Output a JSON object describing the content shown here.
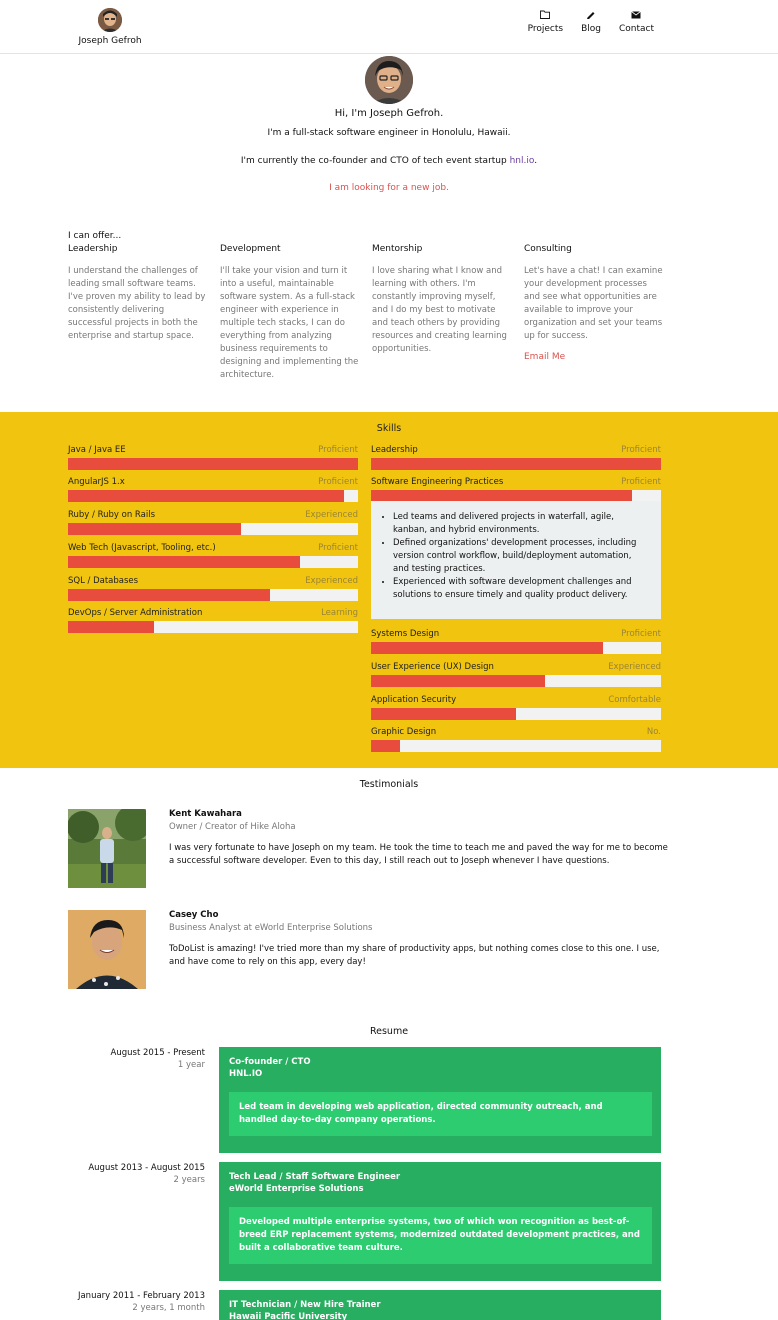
{
  "nav": {
    "brand_name": "Joseph Gefroh",
    "links": [
      {
        "label": "Projects",
        "icon": "folder-icon"
      },
      {
        "label": "Blog",
        "icon": "pencil-icon"
      },
      {
        "label": "Contact",
        "icon": "envelope-icon"
      }
    ]
  },
  "hero": {
    "greeting": "Hi, I'm Joseph Gefroh.",
    "line1": "I'm a full-stack software engineer in Honolulu, Hawaii.",
    "line2_prefix": "I'm currently the co-founder and CTO of tech event startup ",
    "line2_link": "hnl.io",
    "line2_suffix": ".",
    "job_notice": "I am looking for a new job."
  },
  "offers": {
    "title": "I can offer...",
    "items": [
      {
        "title": "Leadership",
        "text": "I understand the challenges of leading small software teams. I've proven my ability to lead by consistently delivering successful projects in both the enterprise and startup space."
      },
      {
        "title": "Development",
        "text": "I'll take your vision and turn it into a useful, maintainable software system. As a full-stack engineer with experience in multiple tech stacks, I can do everything from analyzing business requirements to designing and implementing the architecture."
      },
      {
        "title": "Mentorship",
        "text": "I love sharing what I know and learning with others. I'm constantly improving myself, and I do my best to motivate and teach others by providing resources and creating learning opportunities."
      },
      {
        "title": "Consulting",
        "text": "Let's have a chat! I can examine your development processes and see what opportunities are available to improve your organization and set your teams up for success.",
        "link": "Email Me"
      }
    ]
  },
  "skills": {
    "title": "Skills",
    "left": [
      {
        "name": "Java / Java EE",
        "level": "Proficient",
        "fill": 1.0
      },
      {
        "name": "AngularJS 1.x",
        "level": "Proficient",
        "fill": 0.95
      },
      {
        "name": "Ruby / Ruby on Rails",
        "level": "Experienced",
        "fill": 0.595
      },
      {
        "name": "Web Tech (Javascript, Tooling, etc.)",
        "level": "Proficient",
        "fill": 0.8
      },
      {
        "name": "SQL / Databases",
        "level": "Experienced",
        "fill": 0.695
      },
      {
        "name": "DevOps / Server Administration",
        "level": "Learning",
        "fill": 0.295
      }
    ],
    "right": [
      {
        "name": "Leadership",
        "level": "Proficient",
        "fill": 1.0
      },
      {
        "name": "Software Engineering Practices",
        "level": "Proficient",
        "fill": 0.9
      },
      {
        "name": "Systems Design",
        "level": "Proficient",
        "fill": 0.8
      },
      {
        "name": "User Experience (UX) Design",
        "level": "Experienced",
        "fill": 0.6
      },
      {
        "name": "Application Security",
        "level": "Comfortable",
        "fill": 0.5
      },
      {
        "name": "Graphic Design",
        "level": "No.",
        "fill": 0.1
      }
    ],
    "detail": [
      "Led teams and delivered projects in waterfall, agile, kanban, and hybrid environments.",
      "Defined organizations' development processes, including version control workflow, build/deployment automation, and testing practices.",
      "Experienced with software development challenges and solutions to ensure timely and quality product delivery."
    ]
  },
  "testimonials": {
    "title": "Testimonials",
    "items": [
      {
        "name": "Kent Kawahara",
        "role": "Owner / Creator of Hike Aloha",
        "quote": "I was very fortunate to have Joseph on my team. He took the time to teach me and paved the way for me to become a successful software developer. Even to this day, I still reach out to Joseph whenever I have questions."
      },
      {
        "name": "Casey Cho",
        "role": "Business Analyst at eWorld Enterprise Solutions",
        "quote": "ToDoList is amazing! I've tried more than my share of productivity apps, but nothing comes close to this one. I use, and have come to rely on this app, every day!"
      }
    ]
  },
  "resume": {
    "title": "Resume",
    "jobs": [
      {
        "dates": "August 2015 - Present",
        "duration": "1 year",
        "title": "Co-founder / CTO",
        "company": "HNL.IO",
        "desc": "Led team in developing web application, directed community outreach, and handled day-to-day company operations."
      },
      {
        "dates": "August 2013 - August 2015",
        "duration": "2 years",
        "title": "Tech Lead / Staff Software Engineer",
        "company": "eWorld Enterprise Solutions",
        "desc": "Developed multiple enterprise systems, two of which won recognition as best-of-breed ERP replacement systems, modernized outdated development practices, and built a collaborative team culture."
      },
      {
        "dates": "January 2011 - February 2013",
        "duration": "2 years, 1 month",
        "title": "IT Technician / New Hire Trainer",
        "company": "Hawaii Pacific University"
      }
    ]
  },
  "colors": {
    "skills_bg": "#f1c410",
    "bar_fill": "#e74c3c",
    "resume_card": "#27ae60",
    "resume_desc": "#2ecc71",
    "link_red": "#d9534f"
  }
}
